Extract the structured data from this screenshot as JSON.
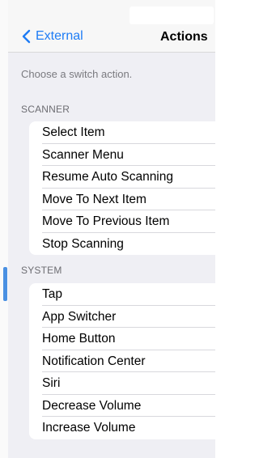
{
  "nav": {
    "back_label": "External",
    "title": "Actions"
  },
  "hint": "Choose a switch action.",
  "sections": [
    {
      "header": "SCANNER",
      "items": [
        "Select Item",
        "Scanner Menu",
        "Resume Auto Scanning",
        "Move To Next Item",
        "Move To Previous Item",
        "Stop Scanning"
      ]
    },
    {
      "header": "SYSTEM",
      "items": [
        "Tap",
        "App Switcher",
        "Home Button",
        "Notification Center",
        "Siri",
        "Decrease Volume",
        "Increase Volume"
      ]
    }
  ],
  "colors": {
    "accent": "#1e7cf5",
    "background": "#efeff4"
  }
}
